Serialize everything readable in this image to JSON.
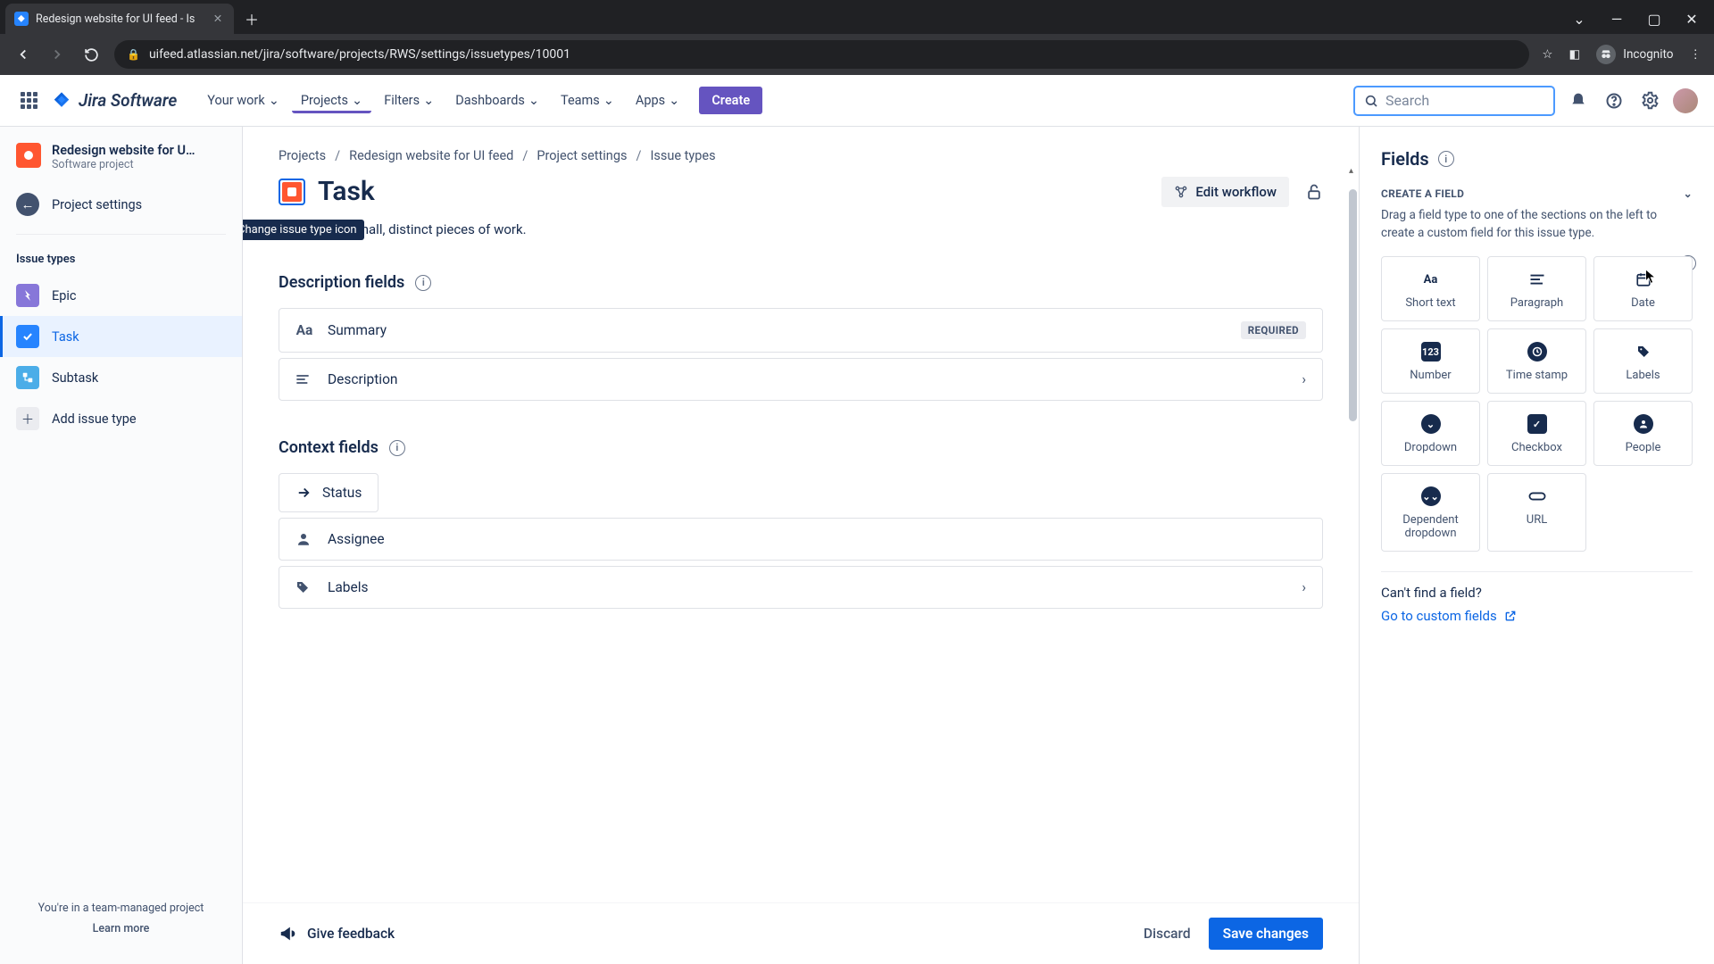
{
  "browser": {
    "tab_title": "Redesign website for UI feed - Is",
    "url": "uifeed.atlassian.net/jira/software/projects/RWS/settings/issuetypes/10001",
    "incognito_label": "Incognito"
  },
  "topnav": {
    "product": "Jira Software",
    "links": [
      "Your work",
      "Projects",
      "Filters",
      "Dashboards",
      "Teams",
      "Apps"
    ],
    "create": "Create",
    "search_placeholder": "Search"
  },
  "sidebar": {
    "project_name": "Redesign website for U…",
    "project_sub": "Software project",
    "back_label": "Project settings",
    "group_label": "Issue types",
    "items": [
      {
        "label": "Epic"
      },
      {
        "label": "Task"
      },
      {
        "label": "Subtask"
      }
    ],
    "add_label": "Add issue type",
    "footer_line": "You're in a team-managed project",
    "footer_link": "Learn more"
  },
  "breadcrumbs": [
    "Projects",
    "Redesign website for UI feed",
    "Project settings",
    "Issue types"
  ],
  "issue_type": {
    "name": "Task",
    "icon_tooltip": "Change issue type icon",
    "description": "Tasks track small, distinct pieces of work.",
    "edit_workflow": "Edit workflow"
  },
  "sections": {
    "description_title": "Description fields",
    "context_title": "Context fields",
    "summary_label": "Summary",
    "required_badge": "REQUIRED",
    "description_label": "Description",
    "status_label": "Status",
    "assignee_label": "Assignee",
    "labels_label": "Labels"
  },
  "footer": {
    "feedback": "Give feedback",
    "discard": "Discard",
    "save": "Save changes"
  },
  "right": {
    "title": "Fields",
    "create_label": "Create a field",
    "create_desc": "Drag a field type to one of the sections on the left to create a custom field for this issue type.",
    "types": [
      "Short text",
      "Paragraph",
      "Date",
      "Number",
      "Time stamp",
      "Labels",
      "Dropdown",
      "Checkbox",
      "People",
      "Dependent dropdown",
      "URL"
    ],
    "find_label": "Can't find a field?",
    "goto_label": "Go to custom fields"
  }
}
